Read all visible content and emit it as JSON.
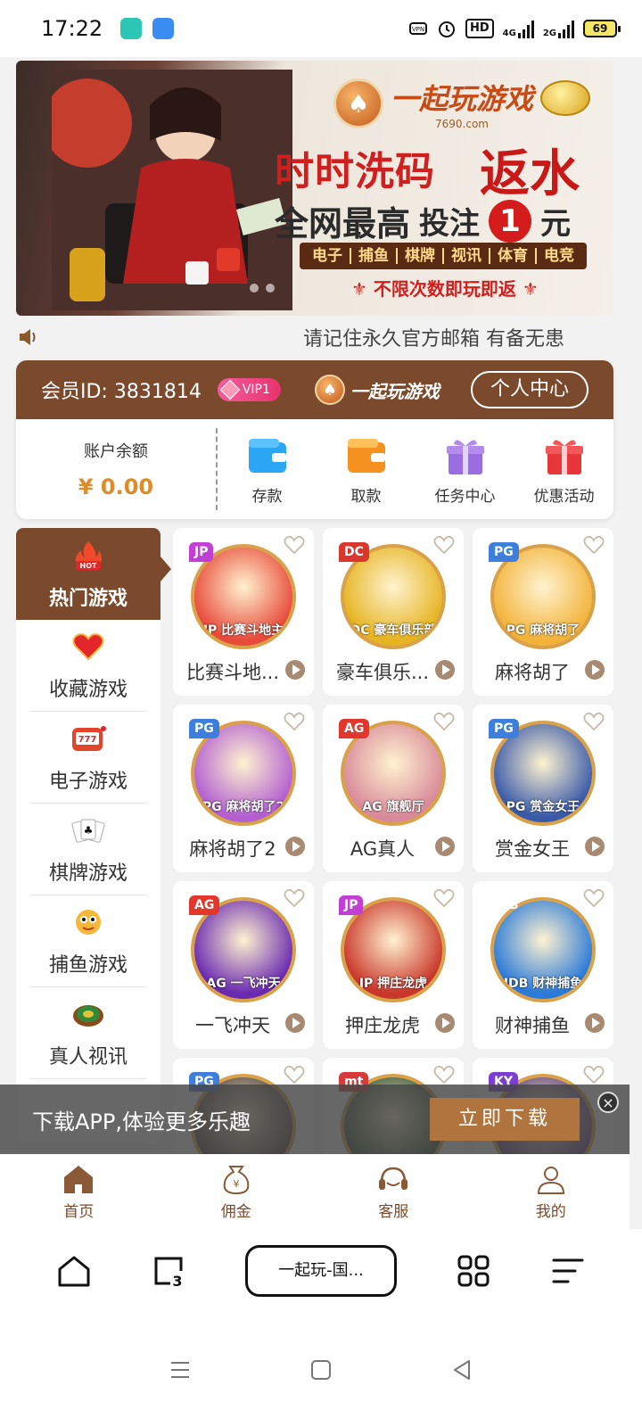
{
  "status_bar": {
    "time": "17:22",
    "net_label": "HD",
    "sig1_label": "4G",
    "sig2_label": "2G",
    "battery": "69"
  },
  "banner": {
    "logo_text": "一起玩游戏",
    "logo_sub": "7690.com",
    "line1": "时时洗码",
    "line1b": "返水",
    "line2_a": "全网最高",
    "line2_b": "投注",
    "line2_num": "1",
    "line2_c": "元",
    "categories": [
      "电子",
      "捕鱼",
      "棋牌",
      "视讯",
      "体育",
      "电竞"
    ],
    "line3": "不限次数即玩即返"
  },
  "marquee": {
    "text": "请记住永久官方邮箱 有备无患"
  },
  "member": {
    "id_label": "会员ID: 3831814",
    "vip": "VIP1",
    "logo_text": "一起玩游戏",
    "center_button": "个人中心",
    "balance_label": "账户余额",
    "balance_value": "¥ 0.00",
    "actions": [
      {
        "label": "存款",
        "icon": "wallet-blue-icon",
        "color": "#2a9bf0"
      },
      {
        "label": "取款",
        "icon": "wallet-orange-icon",
        "color": "#f5911e"
      },
      {
        "label": "任务中心",
        "icon": "gift-purple-icon",
        "color": "#9a6ee0"
      },
      {
        "label": "优惠活动",
        "icon": "gift-red-icon",
        "color": "#e8363a"
      }
    ]
  },
  "side_menu": {
    "items": [
      {
        "label": "热门游戏",
        "icon": "hot-flame-icon"
      },
      {
        "label": "收藏游戏",
        "icon": "heart-icon"
      },
      {
        "label": "电子游戏",
        "icon": "slot-machine-icon"
      },
      {
        "label": "棋牌游戏",
        "icon": "cards-icon"
      },
      {
        "label": "捕鱼游戏",
        "icon": "fish-icon"
      },
      {
        "label": "真人视讯",
        "icon": "roulette-icon"
      }
    ]
  },
  "games": [
    {
      "name": "比赛斗地...",
      "tag": "JP",
      "caption": "JP 比赛斗地主",
      "color": "#e84a3a"
    },
    {
      "name": "豪车俱乐...",
      "tag": "DC",
      "caption": "DC 豪车俱乐部",
      "color": "#e6b421"
    },
    {
      "name": "麻将胡了",
      "tag": "PG",
      "caption": "PG 麻将胡了",
      "color": "#f3b33a"
    },
    {
      "name": "麻将胡了2",
      "tag": "PG",
      "caption": "PG 麻将胡了2",
      "color": "#b35fd0"
    },
    {
      "name": "AG真人",
      "tag": "AG",
      "caption": "AG 旗舰厅",
      "color": "#d98a9a"
    },
    {
      "name": "赏金女王",
      "tag": "PG",
      "caption": "PG 赏金女王",
      "color": "#3a5aa8"
    },
    {
      "name": "一飞冲天",
      "tag": "AG",
      "caption": "AG 一飞冲天",
      "color": "#6a2ab0"
    },
    {
      "name": "押庄龙虎",
      "tag": "JP",
      "caption": "JP 押庄龙虎",
      "color": "#c9362a"
    },
    {
      "name": "财神捕鱼",
      "tag": "JDB",
      "caption": "JDB 财神捕鱼",
      "color": "#2a7ad8"
    },
    {
      "name": "",
      "tag": "PG",
      "caption": "",
      "color": "#4a3a3a"
    },
    {
      "name": "",
      "tag": "mt",
      "caption": "",
      "color": "#2a4a2a"
    },
    {
      "name": "",
      "tag": "KY",
      "caption": "",
      "color": "#5a3a7a"
    }
  ],
  "download": {
    "text": "下载APP,体验更多乐趣",
    "button": "立即下载",
    "close": "×"
  },
  "tabbar": [
    {
      "label": "首页",
      "icon": "home-icon"
    },
    {
      "label": "佣金",
      "icon": "money-bag-icon"
    },
    {
      "label": "客服",
      "icon": "headset-icon"
    },
    {
      "label": "我的",
      "icon": "user-icon"
    }
  ],
  "browser": {
    "url_label": "一起玩-国...",
    "tabs_count": "3"
  }
}
